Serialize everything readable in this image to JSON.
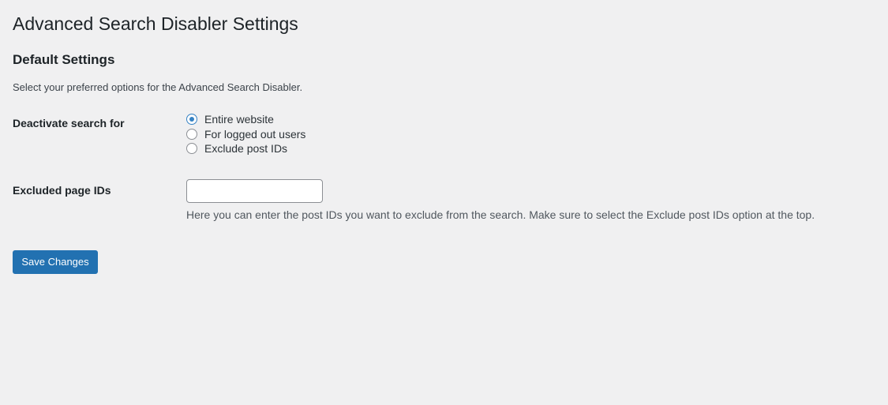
{
  "page": {
    "title": "Advanced Search Disabler Settings"
  },
  "section": {
    "title": "Default Settings",
    "description": "Select your preferred options for the Advanced Search Disabler."
  },
  "deactivate": {
    "label": "Deactivate search for",
    "options": [
      {
        "label": "Entire website",
        "checked": true
      },
      {
        "label": "For logged out users",
        "checked": false
      },
      {
        "label": "Exclude post IDs",
        "checked": false
      }
    ]
  },
  "excluded": {
    "label": "Excluded page IDs",
    "value": "",
    "help": "Here you can enter the post IDs you want to exclude from the search. Make sure to select the Exclude post IDs option at the top."
  },
  "actions": {
    "save_label": "Save Changes"
  },
  "colors": {
    "background": "#f0f0f1",
    "accent": "#2271b1",
    "radio_checked": "#3582c4"
  }
}
